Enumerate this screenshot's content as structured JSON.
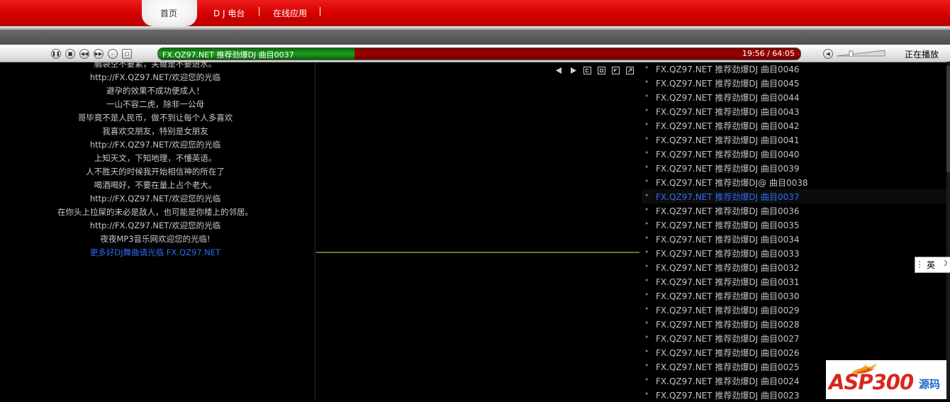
{
  "nav": {
    "items": [
      {
        "label": "首页",
        "active": true
      },
      {
        "label": "D J 电台"
      },
      {
        "label": "在线应用"
      }
    ]
  },
  "player": {
    "track_title": "FX.QZ97.NET 推荐劲爆DJ  曲目0037",
    "time": "19:56 / 64:05",
    "progress": 0.306,
    "status": "正在播放",
    "controls": [
      "pause-icon",
      "stop-icon",
      "prev-icon",
      "next-icon",
      "minimize-icon",
      "window-icon"
    ]
  },
  "lyrics": [
    {
      "text": "脑袋空不要紧，关键是不要进水。"
    },
    {
      "text": "http://FX.QZ97.NET/欢迎您的光临"
    },
    {
      "text": "避孕的效果不成功便成人！"
    },
    {
      "text": "一山不容二虎，除非一公母"
    },
    {
      "text": "哥毕竟不是人民币，做不到让每个人多喜欢"
    },
    {
      "text": "我喜欢交朋友，特别是女朋友"
    },
    {
      "text": "http://FX.QZ97.NET/欢迎您的光临"
    },
    {
      "text": "上知天文，下知地理，不懂英语。"
    },
    {
      "text": "人不胜天的时候我开始相信神的所在了"
    },
    {
      "text": "喝酒喝好，不要在量上占个老大。"
    },
    {
      "text": "http://FX.QZ97.NET/欢迎您的光临"
    },
    {
      "text": "在你头上拉屎的未必是敌人，也可能是你楼上的邻居。"
    },
    {
      "text": "http://FX.QZ97.NET/欢迎您的光临"
    },
    {
      "text": "夜夜MP3音乐网欢迎您的光临!"
    },
    {
      "text": "更多好DJ舞曲请光临 FX.QZ97.NET",
      "link": true
    }
  ],
  "viz_controls": [
    "triangle-left-icon",
    "triangle-right-icon",
    "c-box-icon",
    "d-box-icon",
    "f-box-icon",
    "expand-icon"
  ],
  "playlist": {
    "active_index": 9,
    "items": [
      "FX.QZ97.NET 推荐劲爆DJ  曲目0046",
      "FX.QZ97.NET 推荐劲爆DJ  曲目0045",
      "FX.QZ97.NET 推荐劲爆DJ  曲目0044",
      "FX.QZ97.NET 推荐劲爆DJ  曲目0043",
      "FX.QZ97.NET 推荐劲爆DJ  曲目0042",
      "FX.QZ97.NET 推荐劲爆DJ  曲目0041",
      "FX.QZ97.NET 推荐劲爆DJ  曲目0040",
      "FX.QZ97.NET 推荐劲爆DJ  曲目0039",
      "FX.QZ97.NET 推荐劲爆DJ@ 曲目0038",
      "FX.QZ97.NET 推荐劲爆DJ  曲目0037",
      "FX.QZ97.NET 推荐劲爆DJ  曲目0036",
      "FX.QZ97.NET 推荐劲爆DJ  曲目0035",
      "FX.QZ97.NET 推荐劲爆DJ  曲目0034",
      "FX.QZ97.NET 推荐劲爆DJ  曲目0033",
      "FX.QZ97.NET 推荐劲爆DJ  曲目0032",
      "FX.QZ97.NET 推荐劲爆DJ  曲目0031",
      "FX.QZ97.NET 推荐劲爆DJ  曲目0030",
      "FX.QZ97.NET 推荐劲爆DJ  曲目0029",
      "FX.QZ97.NET 推荐劲爆DJ  曲目0028",
      "FX.QZ97.NET 推荐劲爆DJ  曲目0027",
      "FX.QZ97.NET 推荐劲爆DJ  曲目0026",
      "FX.QZ97.NET 推荐劲爆DJ  曲目0025",
      "FX.QZ97.NET 推荐劲爆DJ  曲目0024",
      "FX.QZ97.NET 推荐劲爆DJ  曲目0023"
    ]
  },
  "ime": {
    "lang": "英",
    "mode_icon": "moon-icon"
  },
  "watermark": {
    "brand": "ASP300",
    "suffix": "源码"
  },
  "colors": {
    "nav_red": "#d40000",
    "link_blue": "#2d6cf0",
    "played_green": "#1da01d",
    "track_red": "#a00000"
  }
}
